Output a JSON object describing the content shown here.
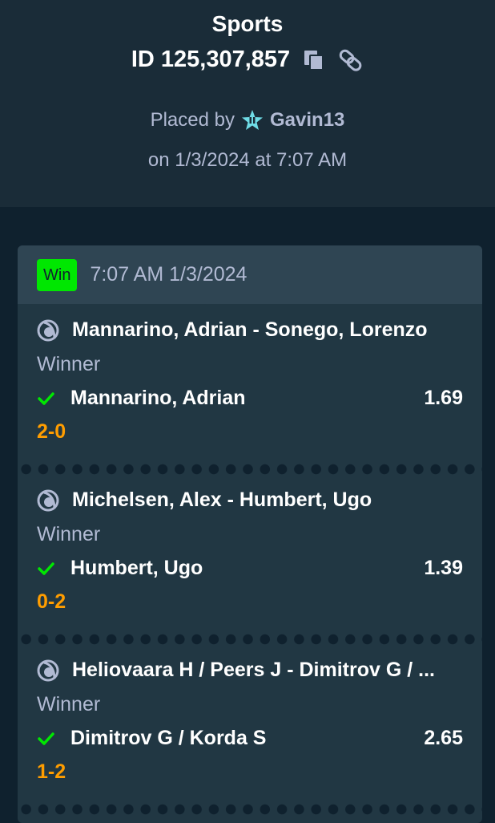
{
  "header": {
    "title": "Sports",
    "bet_id": "ID 125,307,857",
    "placed_by_prefix": "Placed by",
    "username": "Gavin13",
    "placed_on": "on 1/3/2024 at 7:07 AM",
    "icons": {
      "copy": "copy-icon",
      "link": "link-icon",
      "vip": "vip-star-icon"
    }
  },
  "bet": {
    "status": "Win",
    "time": "7:07 AM 1/3/2024",
    "colors": {
      "win": "#00e701",
      "score": "#ff9d00",
      "muted": "#b1bad3"
    },
    "legs": [
      {
        "match": "Mannarino, Adrian - Sonego, Lorenzo",
        "market": "Winner",
        "selection": "Mannarino, Adrian",
        "odds": "1.69",
        "score": "2-0"
      },
      {
        "match": "Michelsen, Alex - Humbert, Ugo",
        "market": "Winner",
        "selection": "Humbert, Ugo",
        "odds": "1.39",
        "score": "0-2"
      },
      {
        "match": "Heliovaara H / Peers J - Dimitrov G / ...",
        "market": "Winner",
        "selection": "Dimitrov G / Korda S",
        "odds": "2.65",
        "score": "1-2"
      }
    ]
  }
}
